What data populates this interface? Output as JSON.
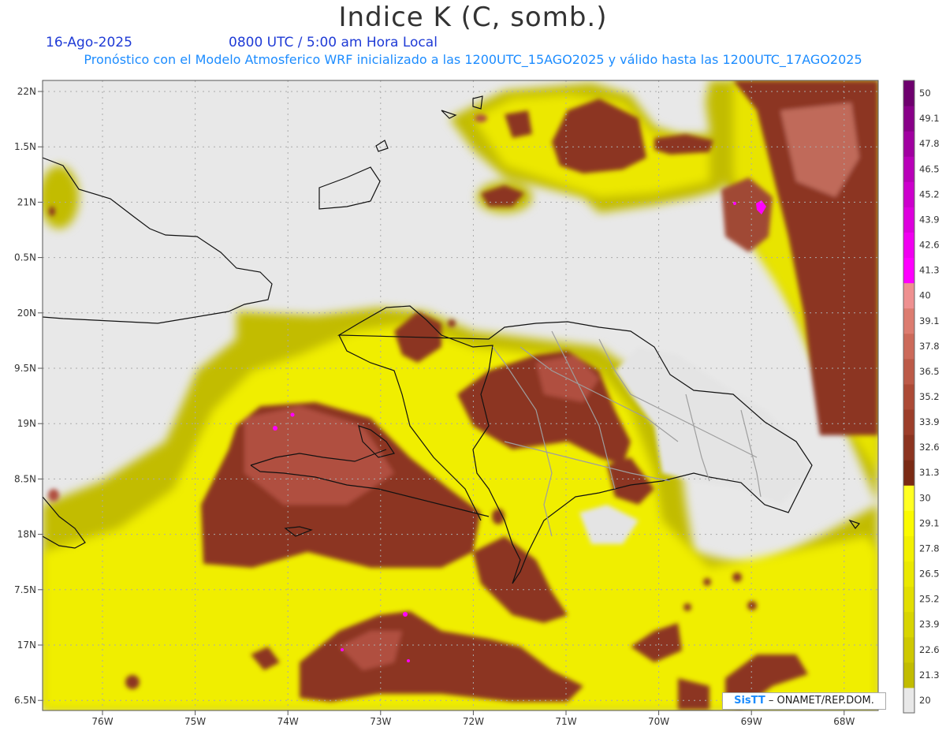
{
  "header": {
    "title": "Indice K (C, somb.)",
    "date": "16-Ago-2025",
    "time": "0800 UTC / 5:00 am Hora Local",
    "model_info": "Pronóstico con el Modelo Atmosferico WRF inicializado a las 1200UTC_15AGO2025 y válido hasta las  1200UTC_17AGO2025"
  },
  "axes": {
    "lat_labels": [
      "22N",
      "1.5N",
      "21N",
      "0.5N",
      "20N",
      "9.5N",
      "19N",
      "8.5N",
      "18N",
      "7.5N",
      "17N",
      "6.5N"
    ],
    "lon_labels": [
      "76W",
      "75W",
      "74W",
      "73W",
      "72W",
      "71W",
      "70W",
      "69W",
      "68W"
    ]
  },
  "colorbar": {
    "labels": [
      "50",
      "49.1",
      "47.8",
      "46.5",
      "45.2",
      "43.9",
      "42.6",
      "41.3",
      "40",
      "39.1",
      "37.8",
      "36.5",
      "35.2",
      "33.9",
      "32.6",
      "31.3",
      "30",
      "29.1",
      "27.8",
      "26.5",
      "25.2",
      "23.9",
      "22.6",
      "21.3",
      "20"
    ],
    "colors": [
      "#e8e8e8",
      "#c2bc00",
      "#cec800",
      "#d8d400",
      "#e2de00",
      "#eae800",
      "#f2f000",
      "#fafa00",
      "#ffff22",
      "#7a2a14",
      "#8c3420",
      "#9c3e2a",
      "#ac4a36",
      "#bc5a48",
      "#cc6a5a",
      "#dc7c70",
      "#ee9090",
      "#ff00ff",
      "#f000f0",
      "#dd00dd",
      "#cc00cc",
      "#b800b8",
      "#a000a0",
      "#880088",
      "#6e006e"
    ]
  },
  "credit": {
    "brand": "SisTT",
    "text": "– ONAMET/REP.DOM."
  }
}
